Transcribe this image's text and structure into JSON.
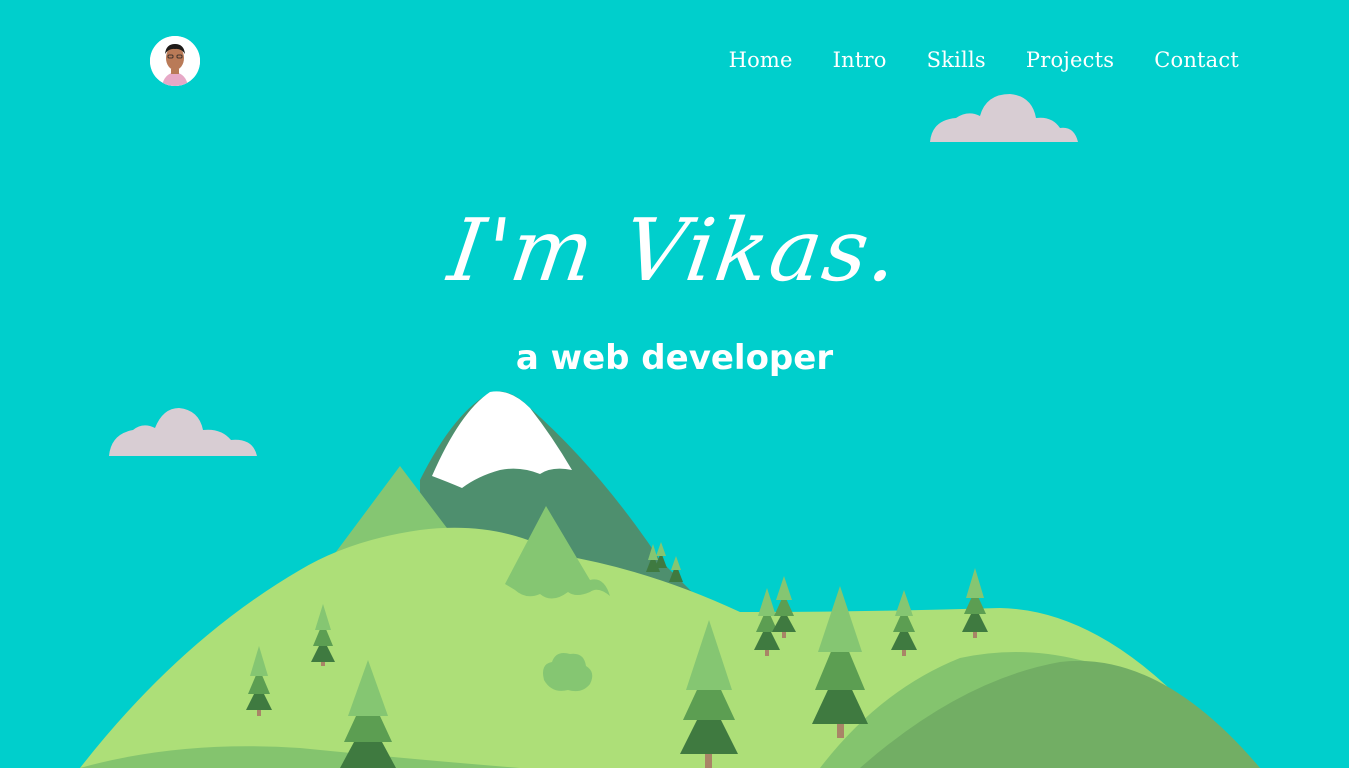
{
  "header": {
    "avatar_alt": "profile photo",
    "nav": {
      "home": "Home",
      "intro": "Intro",
      "skills": "Skills",
      "projects": "Projects",
      "contact": "Contact"
    }
  },
  "hero": {
    "title": "I'm Vikas.",
    "subtitle": "a web developer"
  },
  "colors": {
    "background": "#00CFCC",
    "cloud": "#D8CDD3",
    "snow": "#FFFFFF",
    "mountain_dark": "#4E8F6E",
    "hill_light": "#ADDF78",
    "hill_mid": "#84C46E",
    "hill_dark": "#72AE64",
    "tree_light": "#85C672",
    "tree_mid": "#5C9E52",
    "tree_dark": "#3F7A40",
    "trunk": "#A98467"
  }
}
